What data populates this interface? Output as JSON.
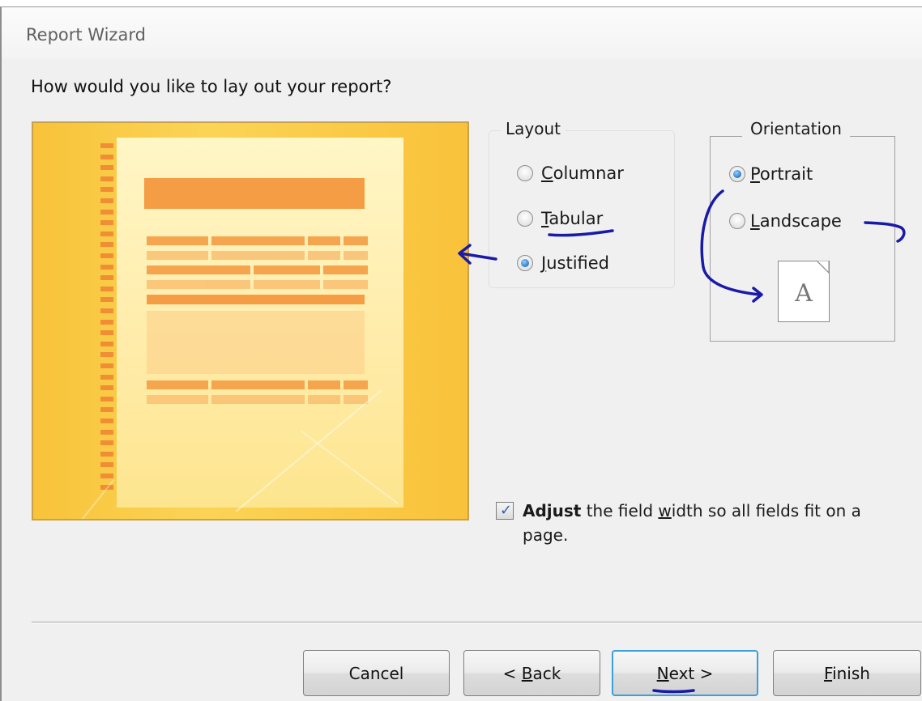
{
  "dialog": {
    "title": "Report Wizard",
    "question": "How would you like to lay out your report?"
  },
  "layout_group": {
    "caption": "Layout",
    "options": [
      {
        "prefix": "",
        "accel": "C",
        "rest": "olumnar",
        "selected": false
      },
      {
        "prefix": "",
        "accel": "T",
        "rest": "abular",
        "selected": false
      },
      {
        "prefix": "",
        "accel": "J",
        "rest": "ustified",
        "selected": true
      }
    ]
  },
  "orientation_group": {
    "caption": "Orientation",
    "options": [
      {
        "accel": "P",
        "rest": "ortrait",
        "selected": true
      },
      {
        "accel": "L",
        "rest": "andscape",
        "selected": false
      }
    ],
    "page_letter": "A"
  },
  "adjust_checkbox": {
    "checked": true,
    "bold": "Adjust",
    "text_before_accel": " the field ",
    "accel": "w",
    "text_after_accel": "idth so all fields fit on a page."
  },
  "buttons": {
    "cancel": "Cancel",
    "back_prefix": "< ",
    "back_accel": "B",
    "back_rest": "ack",
    "next_accel": "N",
    "next_rest": "ext >",
    "finish_accel": "F",
    "finish_rest": "inish"
  },
  "colors": {
    "preview_background": "#f9c23a",
    "preview_accent": "#f49d45",
    "annotation_ink": "#1a1aa8",
    "default_button_border": "#3d9fd6"
  }
}
